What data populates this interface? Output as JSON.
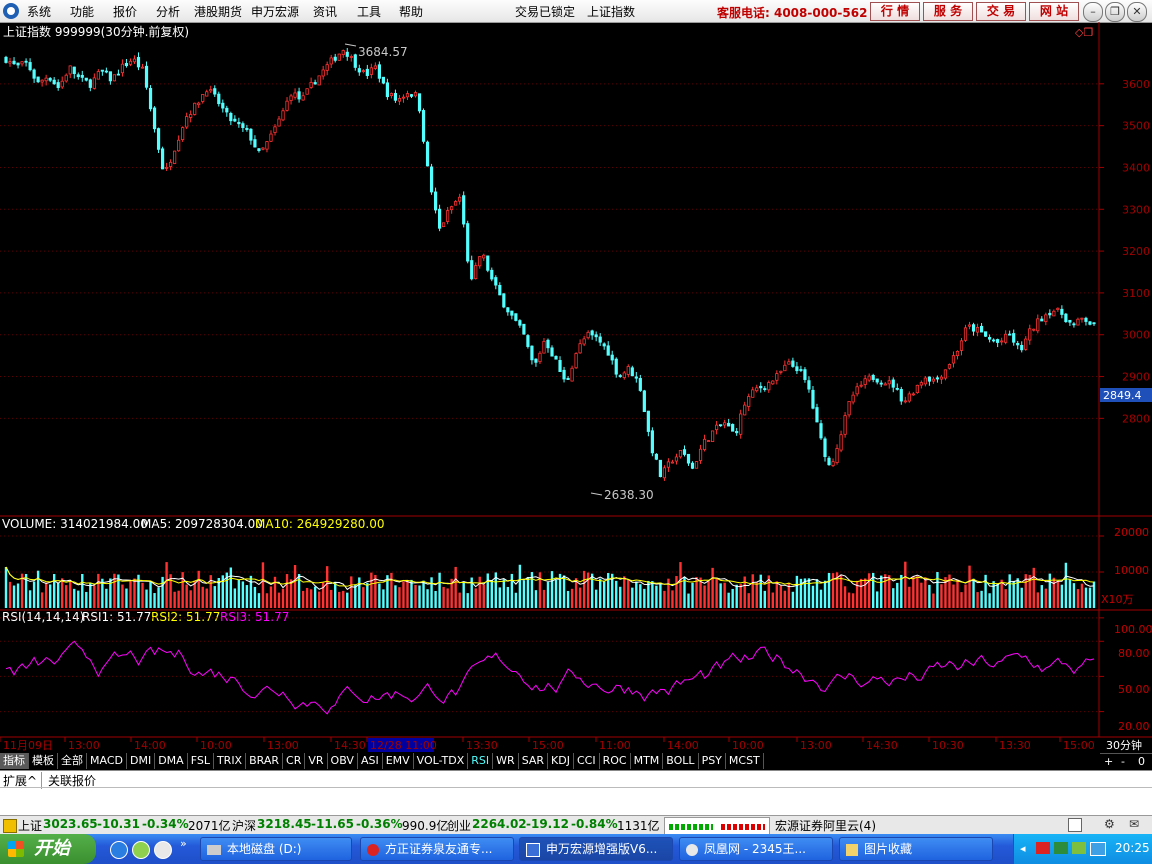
{
  "menu": {
    "items": [
      "系统",
      "功能",
      "报价",
      "分析",
      "港股期货",
      "申万宏源",
      "资讯",
      "工具",
      "帮助"
    ],
    "lock_status": "交易已锁定",
    "current_title": "上证指数",
    "hotline": "客服电话: 4008-000-562",
    "right_buttons": [
      "行 情",
      "服 务",
      "交 易",
      "网 站"
    ]
  },
  "chart": {
    "title": "上证指数 999999(30分钟.前复权)",
    "high_label": "3684.57",
    "low_label": "2638.30",
    "current_price_tag": "2849.4",
    "price_ticks": [
      "3600",
      "3500",
      "3400",
      "3300",
      "3200",
      "3100",
      "3000",
      "2900",
      "2800"
    ],
    "volume_header": {
      "label": "VOLUME: 314021984.00",
      "ma5": "MA5: 209728304.00",
      "ma10": "MA10: 264929280.00"
    },
    "volume_ticks": [
      "20000",
      "10000"
    ],
    "volume_unit": "X10万",
    "rsi_header": {
      "label": "RSI(14,14,14)",
      "rsi1": "RSI1: 51.77",
      "rsi2": "RSI2: 51.77",
      "rsi3": "RSI3: 51.77"
    },
    "rsi_ticks": [
      "100.00",
      "80.00",
      "50.00",
      "20.00"
    ],
    "time_labels": [
      "11月09日",
      "13:00",
      "14:00",
      "10:00",
      "13:00",
      "14:30",
      "12/28 11:00",
      "13:30",
      "15:00",
      "11:00",
      "14:00",
      "10:00",
      "13:00",
      "14:30",
      "10:30",
      "13:30",
      "15:00"
    ],
    "period": "30分钟",
    "colors": {
      "up": "#ff3232",
      "down": "#54ffff",
      "axis": "#a00000",
      "ma5": "#ffffff",
      "ma10": "#ffff00",
      "rsi": "#ff00ff",
      "highlight": "#0000a0"
    }
  },
  "chart_data": {
    "type": "candlestick",
    "title": "上证指数 999999(30分钟.前复权)",
    "ylim": [
      2600,
      3700
    ],
    "price_path": [
      3660,
      3640,
      3650,
      3600,
      3620,
      3590,
      3640,
      3610,
      3600,
      3630,
      3610,
      3640,
      3660,
      3630,
      3500,
      3380,
      3450,
      3520,
      3550,
      3590,
      3560,
      3520,
      3500,
      3480,
      3430,
      3470,
      3520,
      3580,
      3560,
      3600,
      3630,
      3660,
      3684,
      3650,
      3620,
      3640,
      3580,
      3560,
      3580,
      3570,
      3380,
      3250,
      3300,
      3330,
      3120,
      3200,
      3130,
      3080,
      3040,
      3000,
      2920,
      2990,
      2940,
      2880,
      2960,
      3000,
      2990,
      2960,
      2900,
      2920,
      2880,
      2740,
      2660,
      2700,
      2720,
      2680,
      2740,
      2770,
      2790,
      2760,
      2840,
      2870,
      2880,
      2900,
      2930,
      2920,
      2870,
      2760,
      2680,
      2760,
      2850,
      2880,
      2900,
      2890,
      2880,
      2840,
      2870,
      2900,
      2890,
      2920,
      2960,
      3020,
      3010,
      2990,
      2980,
      3000,
      2960,
      3010,
      3040,
      3060,
      3050,
      3020,
      3040,
      3020
    ],
    "high": 3684.57,
    "low": 2638.3,
    "volume_ylim": [
      0,
      25000
    ],
    "rsi_ylim": [
      0,
      105
    ]
  },
  "tabs": [
    "指标",
    "模板",
    "全部",
    "MACD",
    "DMI",
    "DMA",
    "FSL",
    "TRIX",
    "BRAR",
    "CR",
    "VR",
    "OBV",
    "ASI",
    "EMV",
    "VOL-TDX",
    "RSI",
    "WR",
    "SAR",
    "KDJ",
    "CCI",
    "ROC",
    "MTM",
    "BOLL",
    "PSY",
    "MCST"
  ],
  "sub_tabs": [
    "扩展^",
    "关联报价"
  ],
  "nav_buttons": [
    "+",
    "-",
    "0"
  ],
  "status": {
    "sh": {
      "name": "上证",
      "price": "3023.65",
      "change": "-10.31",
      "pct": "-0.34%",
      "amount": "2071亿"
    },
    "hs": {
      "name": "沪深",
      "price": "3218.45",
      "change": "-11.65",
      "pct": "-0.36%",
      "amount": "990.9亿"
    },
    "cy": {
      "name": "创业",
      "price": "2264.02",
      "change": "-19.12",
      "pct": "-0.84%",
      "amount": "1131亿"
    },
    "server": "宏源证券阿里云(4)"
  },
  "taskbar": {
    "start": "开始",
    "tasks": [
      "本地磁盘 (D:)",
      "方正证券泉友通专...",
      "申万宏源增强版V6...",
      "凤凰网 - 2345王...",
      "图片收藏"
    ],
    "clock": "20:25"
  }
}
